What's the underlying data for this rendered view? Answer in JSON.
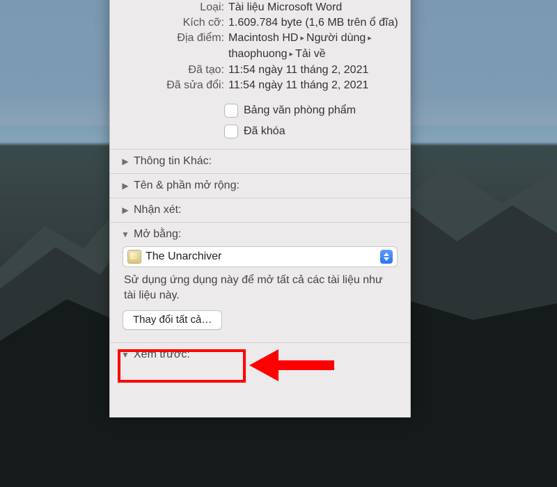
{
  "properties": {
    "type_label": "Loại:",
    "type_value": "Tài liệu Microsoft Word",
    "size_label": "Kích cỡ:",
    "size_value": "1.609.784 byte (1,6 MB trên ổ đĩa)",
    "size_line2": "ổ đĩa)",
    "location_label": "Địa điểm:",
    "location_line1_a": "Macintosh HD",
    "location_line1_b": "Người dùng",
    "location_line2_a": "thaophuong",
    "location_line2_b": "Tải về",
    "created_label": "Đã tạo:",
    "created_value": "11:54 ngày 11 tháng 2, 2021",
    "modified_label": "Đã sửa đổi:",
    "modified_value": "11:54 ngày 11 tháng 2, 2021"
  },
  "checks": {
    "stationery": "Bảng văn phòng phẩm",
    "locked": "Đã khóa"
  },
  "sections": {
    "more_info": "Thông tin Khác:",
    "name_ext": "Tên & phần mở rộng:",
    "comments": "Nhận xét:",
    "open_with": "Mở bằng:",
    "preview": "Xem trước:"
  },
  "open_with": {
    "app": "The Unarchiver",
    "help": "Sử dụng ứng dụng này để mở tất cả các tài liệu như tài liệu này.",
    "change_all": "Thay đổi tất cả…"
  }
}
